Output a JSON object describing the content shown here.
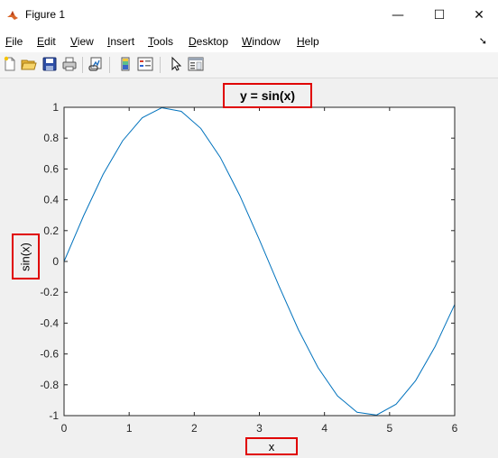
{
  "window": {
    "title": "Figure 1",
    "minimize_glyph": "—",
    "maximize_glyph": "☐",
    "close_glyph": "✕"
  },
  "menubar": {
    "items": [
      {
        "mnemonic": "F",
        "rest": "ile"
      },
      {
        "mnemonic": "E",
        "rest": "dit"
      },
      {
        "mnemonic": "V",
        "rest": "iew"
      },
      {
        "mnemonic": "I",
        "rest": "nsert"
      },
      {
        "mnemonic": "T",
        "rest": "ools"
      },
      {
        "mnemonic": "D",
        "rest": "esktop"
      },
      {
        "mnemonic": "W",
        "rest": "indow"
      },
      {
        "mnemonic": "H",
        "rest": "elp"
      }
    ],
    "overflow_glyph": "➘"
  },
  "toolbar": {
    "icons": [
      "new-figure-icon",
      "open-file-icon",
      "save-icon",
      "print-icon",
      "link-plot-icon",
      "insert-colorbar-icon",
      "insert-legend-icon",
      "edit-plot-pointer-icon",
      "property-inspector-icon"
    ]
  },
  "colors": {
    "annotation_box": "#e00000",
    "line": "#0072bd"
  },
  "chart_data": {
    "type": "line",
    "title": "y = sin(x)",
    "xlabel": "x",
    "ylabel": "sin(x)",
    "xlim": [
      0,
      6
    ],
    "ylim": [
      -1,
      1
    ],
    "xticks": [
      0,
      1,
      2,
      3,
      4,
      5,
      6
    ],
    "yticks": [
      1,
      0.8,
      0.6,
      0.4,
      0.2,
      0,
      -0.2,
      -0.4,
      -0.6,
      -0.8,
      -1
    ],
    "grid": false,
    "series": [
      {
        "x": [
          0,
          0.3,
          0.6,
          0.9,
          1.2,
          1.5,
          1.8,
          2.1,
          2.4,
          2.7,
          3.0,
          3.3,
          3.6,
          3.9,
          4.2,
          4.5,
          4.8,
          5.1,
          5.4,
          5.7,
          6.0
        ],
        "y": [
          0,
          0.296,
          0.565,
          0.783,
          0.932,
          0.997,
          0.974,
          0.863,
          0.675,
          0.427,
          0.141,
          -0.158,
          -0.443,
          -0.688,
          -0.872,
          -0.978,
          -0.996,
          -0.926,
          -0.773,
          -0.551,
          -0.279
        ]
      }
    ]
  }
}
